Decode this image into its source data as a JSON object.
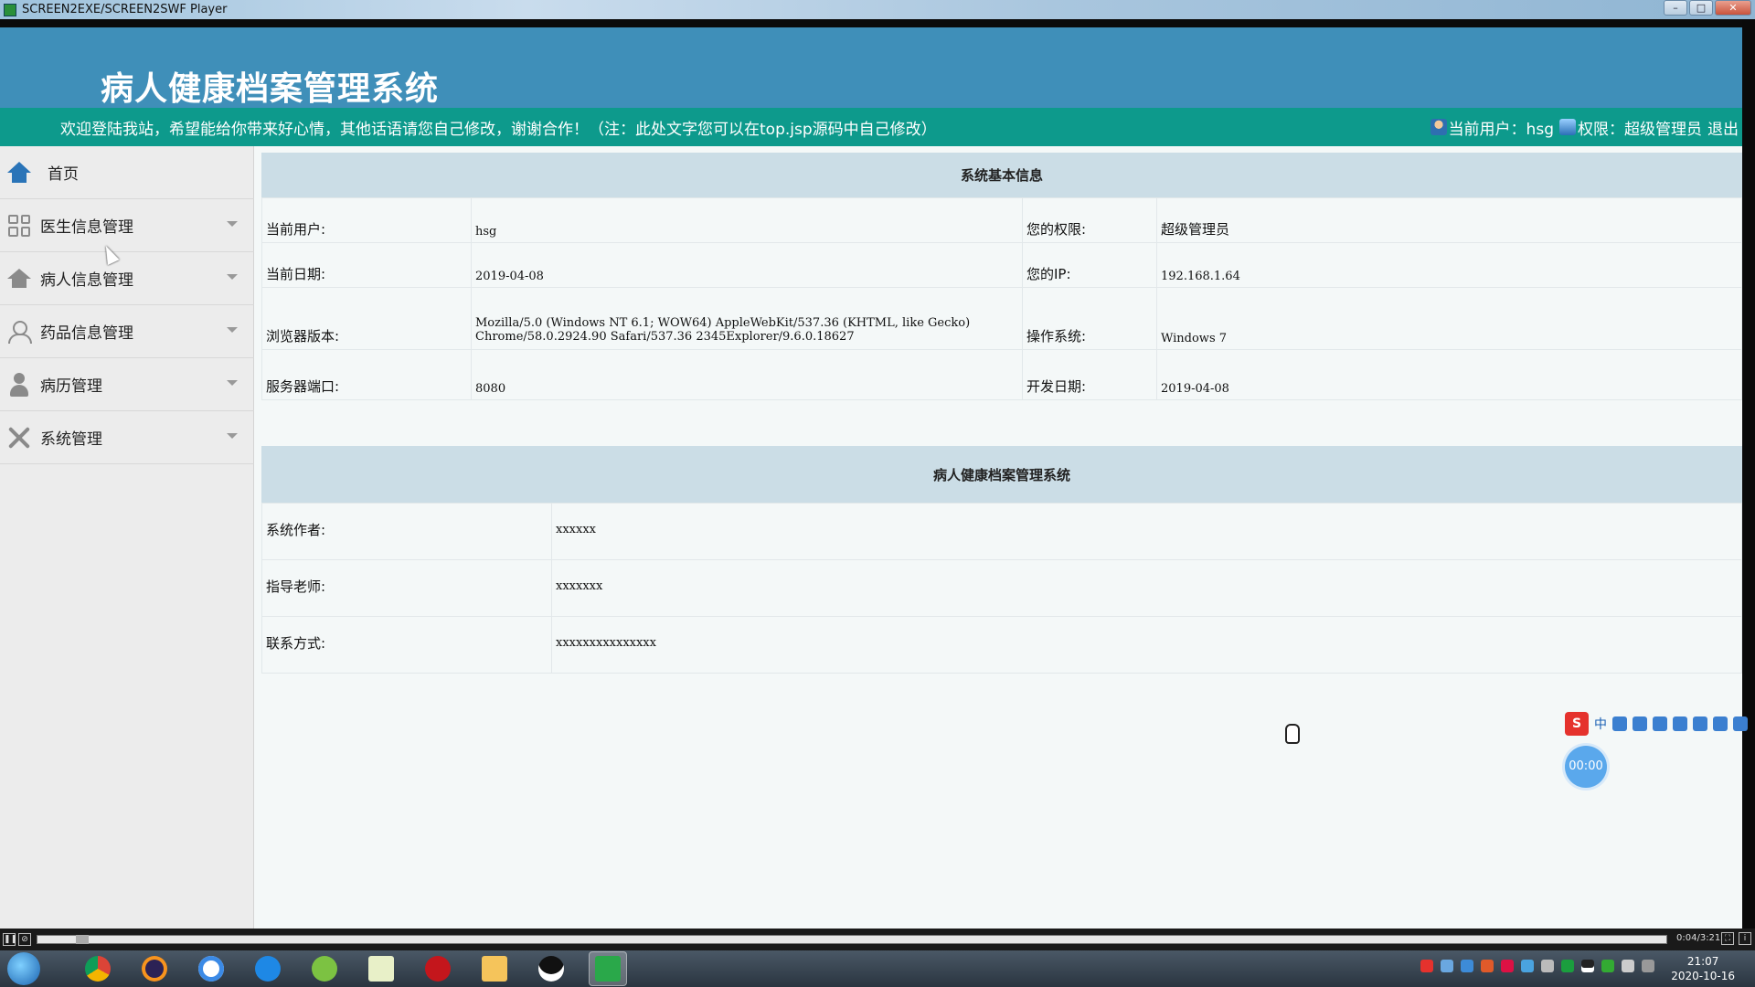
{
  "window": {
    "title": "SCREEN2EXE/SCREEN2SWF Player"
  },
  "header": {
    "system_title": "病人健康档案管理系统",
    "welcome": "欢迎登陆我站，希望能给你带来好心情，其他话语请您自己修改，谢谢合作！（注：此处文字您可以在top.jsp源码中自己修改）",
    "current_user": "当前用户：hsg",
    "permission": "权限：超级管理员",
    "logout": "退出"
  },
  "sidebar": {
    "items": [
      {
        "label": "首页",
        "icon": "home-icon"
      },
      {
        "label": "医生信息管理",
        "icon": "grid-icon"
      },
      {
        "label": "病人信息管理",
        "icon": "house-icon"
      },
      {
        "label": "药品信息管理",
        "icon": "people-icon"
      },
      {
        "label": "病历管理",
        "icon": "person-icon"
      },
      {
        "label": "系统管理",
        "icon": "tools-icon"
      }
    ]
  },
  "system_info": {
    "heading": "系统基本信息",
    "rows": [
      {
        "k1": "当前用户:",
        "v1": "hsg",
        "k2": "您的权限:",
        "v2": "超级管理员"
      },
      {
        "k1": "当前日期:",
        "v1": "2019-04-08",
        "k2": "您的IP:",
        "v2": "192.168.1.64"
      },
      {
        "k1": "浏览器版本:",
        "v1a": "Mozilla/5.0 (Windows NT 6.1; WOW64) AppleWebKit/537.36 (KHTML, like Gecko)",
        "v1b": "Chrome/58.0.2924.90 Safari/537.36 2345Explorer/9.6.0.18627",
        "k2": "操作系统:",
        "v2": "Windows 7"
      },
      {
        "k1": "服务器端口:",
        "v1": "8080",
        "k2": "开发日期:",
        "v2": "2019-04-08"
      }
    ]
  },
  "about": {
    "heading": "病人健康档案管理系统",
    "rows": [
      {
        "k": "系统作者:",
        "v": "xxxxxx"
      },
      {
        "k": "指导老师:",
        "v": "xxxxxxx"
      },
      {
        "k": "联系方式:",
        "v": "xxxxxxxxxxxxxxx"
      }
    ]
  },
  "ime": {
    "logo": "S",
    "mode": "中"
  },
  "timer": "00:00",
  "player": {
    "time": "0:04/3:21"
  },
  "taskbar": {
    "time": "21:07",
    "date": "2020-10-16"
  }
}
